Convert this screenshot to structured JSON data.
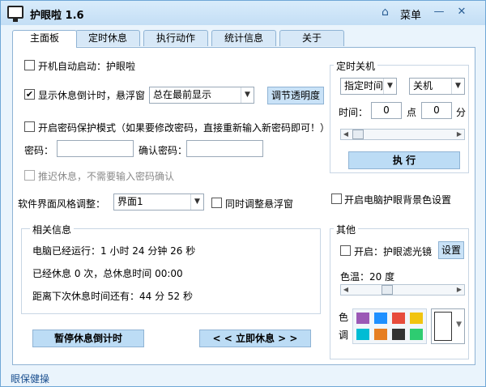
{
  "app": {
    "title": "护眼啦 1.6",
    "menu": "菜单",
    "minimize": "—",
    "close": "✕"
  },
  "tabs": [
    "主面板",
    "定时休息",
    "执行动作",
    "统计信息",
    "关于"
  ],
  "main": {
    "autostart": "开机自动启动：护眼啦",
    "show_countdown": "显示休息倒计时，悬浮窗",
    "float_mode": "总在最前显示",
    "opacity_button": "调节透明度",
    "password_mode": "开启密码保护模式（如果要修改密码，直接重新输入新密码即可！）",
    "password_label": "密码：",
    "confirm_label": "确认密码：",
    "delay_rest": "推迟休息，不需要输入密码确认",
    "style_label": "软件界面风格调整：",
    "style_value": "界面1",
    "sync_float": "同时调整悬浮窗",
    "info_title": "相关信息",
    "info_uptime": "电脑已经运行：1 小时 24 分钟 26 秒",
    "info_rest": "已经休息 0 次，总休息时间 00:00",
    "info_next": "距离下次休息时间还有：44 分 52 秒",
    "pause_button": "暂停休息倒计时",
    "rest_now_button": "< < 立即休息 > >"
  },
  "shutdown": {
    "title": "定时关机",
    "mode": "指定时间",
    "action": "关机",
    "time_label": "时间：",
    "hour": "0",
    "point_label": "点",
    "minute": "0",
    "minute_label": "分",
    "execute": "执  行"
  },
  "bg_color": "开启电脑护眼背景色设置",
  "other": {
    "title": "其他",
    "filter": "开启：护眼滤光镜",
    "settings": "设置",
    "temp_label": "色温：20 度",
    "color_label_1": "色",
    "color_label_2": "调",
    "colors": [
      "#9b59b6",
      "#1e90ff",
      "#e74c3c",
      "#f1c40f",
      "#00bcd4",
      "#e67e22",
      "#333333",
      "#2ecc71"
    ]
  },
  "status": "眼保健操"
}
